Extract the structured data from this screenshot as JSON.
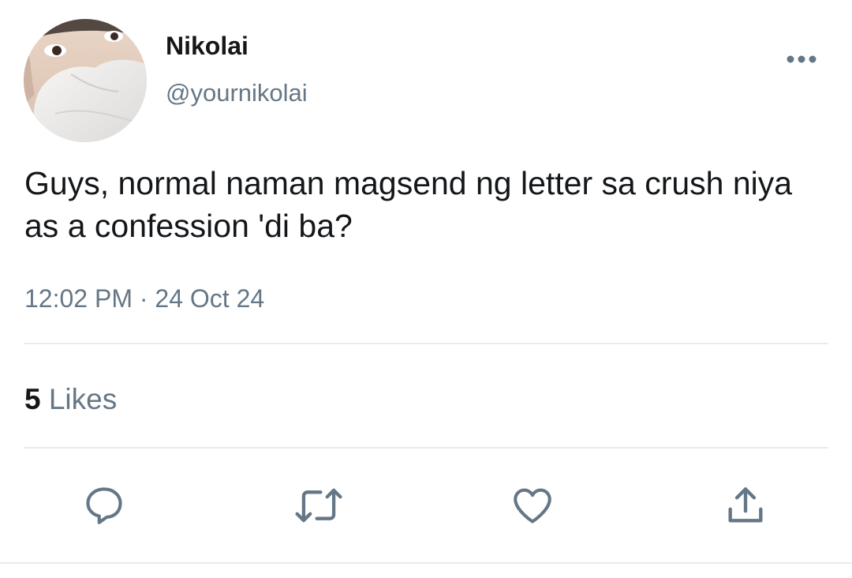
{
  "tweet": {
    "author": {
      "display_name": "Nikolai",
      "handle": "@yournikolai"
    },
    "text": "Guys, normal naman magsend ng letter sa crush niya as a confession 'di ba?",
    "timestamp": "12:02 PM · 24 Oct 24",
    "likes_count": "5",
    "likes_label": "Likes"
  },
  "icons": {
    "more": "more-horizontal-icon",
    "reply": "reply-icon",
    "retweet": "retweet-icon",
    "like": "heart-icon",
    "share": "share-icon"
  },
  "colors": {
    "primary_text": "#14171a",
    "secondary_text": "#657786",
    "divider": "#e6ecf0",
    "icon": "#657786"
  }
}
